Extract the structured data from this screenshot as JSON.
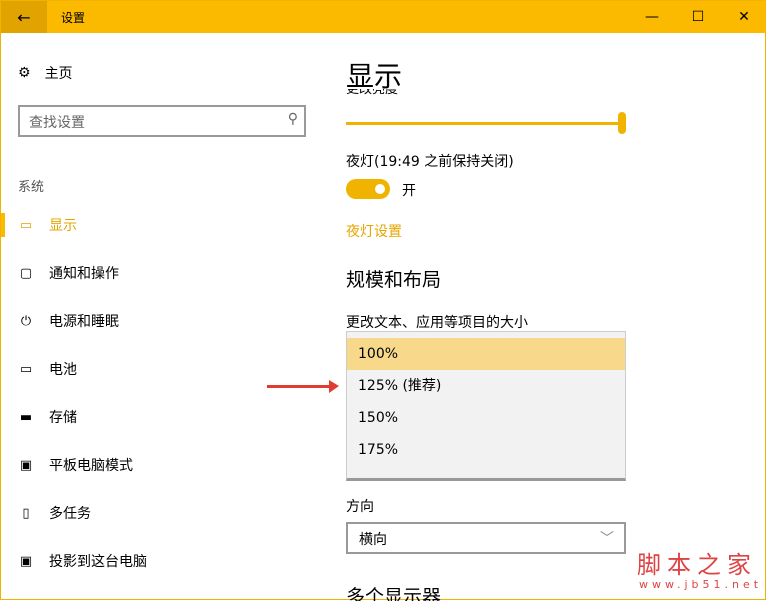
{
  "window": {
    "title": "设置",
    "back": "←",
    "minimize": "—",
    "maximize": "☐",
    "close": "✕"
  },
  "sidebar": {
    "home": "主页",
    "search_placeholder": "查找设置",
    "category": "系统",
    "items": [
      {
        "label": "显示",
        "icon": "▭"
      },
      {
        "label": "通知和操作",
        "icon": "▢"
      },
      {
        "label": "电源和睡眠",
        "icon": "⏻"
      },
      {
        "label": "电池",
        "icon": "▭"
      },
      {
        "label": "存储",
        "icon": "▬"
      },
      {
        "label": "平板电脑模式",
        "icon": "▣"
      },
      {
        "label": "多任务",
        "icon": "▯"
      },
      {
        "label": "投影到这台电脑",
        "icon": "▣"
      }
    ]
  },
  "main": {
    "title": "显示",
    "brightness_label": "更改亮度",
    "brightness_value": 100,
    "night_light_label": "夜灯(19:49 之前保持关闭)",
    "toggle_state": "开",
    "night_light_link": "夜灯设置",
    "scale_heading": "规模和布局",
    "scale_label": "更改文本、应用等项目的大小",
    "scale_options": [
      "100%",
      "125% (推荐)",
      "150%",
      "175%"
    ],
    "orientation_label": "方向",
    "orientation_value": "横向",
    "next_heading": "多个显示器"
  },
  "watermark": {
    "name": "脚本之家",
    "url": "www.jb51.net"
  }
}
